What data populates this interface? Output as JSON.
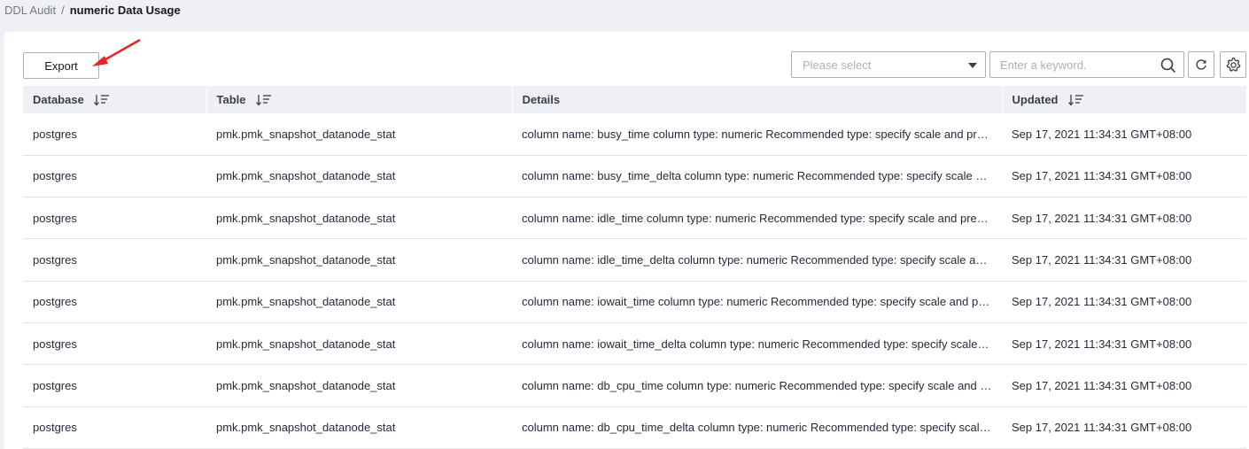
{
  "breadcrumb": {
    "parent": "DDL Audit",
    "separator": "/",
    "current": "numeric Data Usage"
  },
  "toolbar": {
    "export_label": "Export",
    "select_placeholder": "Please select",
    "search_placeholder": "Enter a keyword.",
    "annotation_color": "#e52525"
  },
  "table": {
    "headers": {
      "database": "Database",
      "table": "Table",
      "details": "Details",
      "updated": "Updated"
    },
    "rows": [
      {
        "database": "postgres",
        "table": "pmk.pmk_snapshot_datanode_stat",
        "details": "column name: busy_time column type: numeric Recommended type: specify scale and precision",
        "updated": "Sep 17, 2021 11:34:31 GMT+08:00"
      },
      {
        "database": "postgres",
        "table": "pmk.pmk_snapshot_datanode_stat",
        "details": "column name: busy_time_delta column type: numeric Recommended type: specify scale and precision",
        "updated": "Sep 17, 2021 11:34:31 GMT+08:00"
      },
      {
        "database": "postgres",
        "table": "pmk.pmk_snapshot_datanode_stat",
        "details": "column name: idle_time column type: numeric Recommended type: specify scale and precision",
        "updated": "Sep 17, 2021 11:34:31 GMT+08:00"
      },
      {
        "database": "postgres",
        "table": "pmk.pmk_snapshot_datanode_stat",
        "details": "column name: idle_time_delta column type: numeric Recommended type: specify scale and precision",
        "updated": "Sep 17, 2021 11:34:31 GMT+08:00"
      },
      {
        "database": "postgres",
        "table": "pmk.pmk_snapshot_datanode_stat",
        "details": "column name: iowait_time column type: numeric Recommended type: specify scale and precision",
        "updated": "Sep 17, 2021 11:34:31 GMT+08:00"
      },
      {
        "database": "postgres",
        "table": "pmk.pmk_snapshot_datanode_stat",
        "details": "column name: iowait_time_delta column type: numeric Recommended type: specify scale and precision",
        "updated": "Sep 17, 2021 11:34:31 GMT+08:00"
      },
      {
        "database": "postgres",
        "table": "pmk.pmk_snapshot_datanode_stat",
        "details": "column name: db_cpu_time column type: numeric Recommended type: specify scale and precision",
        "updated": "Sep 17, 2021 11:34:31 GMT+08:00"
      },
      {
        "database": "postgres",
        "table": "pmk.pmk_snapshot_datanode_stat",
        "details": "column name: db_cpu_time_delta column type: numeric Recommended type: specify scale and precision",
        "updated": "Sep 17, 2021 11:34:31 GMT+08:00"
      }
    ]
  }
}
